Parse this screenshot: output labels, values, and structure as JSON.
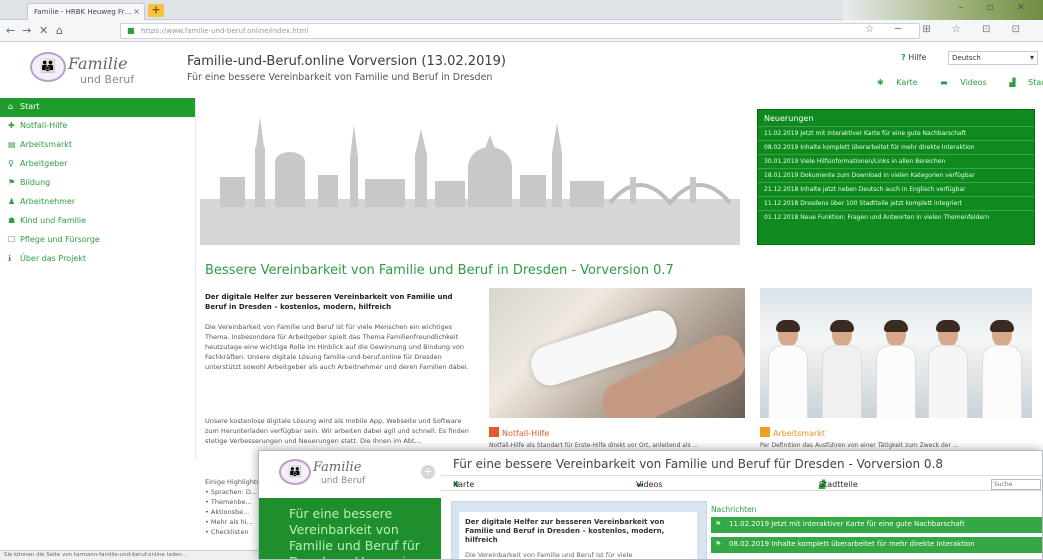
{
  "browser": {
    "tab_title": "Familie - HRBK Heuweg Fr…",
    "tab_close": "×",
    "new_tab": "+",
    "window_controls": "– ▫ ✕",
    "nav": {
      "back": "←",
      "forward": "→",
      "close": "✕",
      "home": "⌂"
    },
    "url": "https://www.familie-und-beruf.online/index.html",
    "toolbar_icons": "☆ ─ ⊞ ☆   ⊡ ⊡"
  },
  "header": {
    "logo_line1": "Familie",
    "logo_line2": "und Beruf",
    "title": "Familie-und-Beruf.online Vorversion (13.02.2019)",
    "subtitle": "Für eine bessere Vereinbarkeit von Familie und Beruf in Dresden",
    "help_label": "Hilfe",
    "language": "Deutsch",
    "links": [
      "Karte",
      "Videos",
      "Stadtteile"
    ]
  },
  "sidebar": {
    "items": [
      {
        "icon": "⌂",
        "label": "Start",
        "active": true
      },
      {
        "icon": "✚",
        "label": "Notfall-Hilfe"
      },
      {
        "icon": "▤",
        "label": "Arbeitsmarkt"
      },
      {
        "icon": "♀",
        "label": "Arbeitgeber"
      },
      {
        "icon": "⚑",
        "label": "Bildung"
      },
      {
        "icon": "♟",
        "label": "Arbeitnehmer"
      },
      {
        "icon": "☗",
        "label": "Kind und Familie"
      },
      {
        "icon": "☐",
        "label": "Pflege und Fürsorge"
      },
      {
        "icon": "ℹ",
        "label": "Über das Projekt"
      }
    ]
  },
  "news": {
    "title": "Neuerungen",
    "items": [
      "11.02.2019 Jetzt mit interaktiver Karte für eine gute Nachbarschaft",
      "08.02.2019 Inhalte komplett überarbeitet für mehr direkte Interaktion",
      "30.01.2019 Viele Hilfsinformationen/Links in allen Bereichen",
      "18.01.2019 Dokumente zum Download in vielen Kategorien verfügbar",
      "21.12.2018 Inhalte jetzt neben Deutsch auch in Englisch verfügbar",
      "11.12.2018 Dresdens über 100 Stadtteile jetzt komplett integriert",
      "01.12.2018 Neue Funktion: Fragen und Antworten in vielen Themenfeldern"
    ]
  },
  "main": {
    "title": "Bessere Vereinbarkeit von Familie und Beruf in Dresden - Vorversion 0.7",
    "lead": "Der digitale Helfer zur besseren Vereinbarkeit von Familie und Beruf in Dresden – kostenlos, modern, hilfreich",
    "para1": "Die Vereinbarkeit von Familie und Beruf ist für viele Menschen ein wichtiges Thema. Insbesondere für Arbeitgeber spielt das Thema Familienfreundlichkeit heutzutage eine wichtige Rolle im Hinblick auf die Gewinnung und Bindung von Fachkräften. Unsere digitale Lösung familie-und-beruf.online für Dresden unterstützt sowohl Arbeitgeber als auch Arbeitnehmer und deren Familien dabei.",
    "para2": "Unsere kostenlose digitale Lösung wird als mobile App, Webseite und Software zum Herunterladen verfügbar sein. Wir arbeiten dabei agil und schnell. Es finden stetige Verbesserungen und Neuerungen statt. Die Ihnen im Abt...",
    "para3": "Einige Highlights:\n• Sprachen: D...\n• Themenbe...\n• Aktionsbe...\n• Mehr als hi...\n• Checklisten",
    "card1_title": "Notfall-Hilfe",
    "card1_desc": "Notfall-Hilfe als Standart für Erste-Hilfe direkt vor Ort, anleitend als ...",
    "card2_title": "Arbeitsmarkt",
    "card2_desc": "Per Definition das Ausführen von einer Tätigkeit zum Zweck der ..."
  },
  "status_bar": "Sie können die Seite von tarmann-familie-und-beruf.online laden...",
  "window2": {
    "logo_line1": "Familie",
    "logo_line2": "und Beruf",
    "plus": "+",
    "tagline": "Für eine bessere Vereinbarkeit von Familie und Beruf für Dresden – Vorversion 0.8",
    "title": "Für eine bessere Vereinbarkeit von Familie und Beruf für Dresden - Vorversion 0.8",
    "nav": [
      "Karte",
      "Videos",
      "Stadtteile"
    ],
    "search_placeholder": "Suche",
    "box_title": "Der digitale Helfer zur besseren Vereinbarkeit von Familie und Beruf in Dresden – kostenlos, modern, hilfreich",
    "box_sub": "Die Vereinbarkeit von Familie und Beruf ist für viele",
    "news_head": "Nachrichten",
    "news": [
      "11.02.2019  Jetzt mit interaktiver Karte für eine gute Nachbarschaft",
      "08.02.2019  Inhalte komplett überarbeitet für mehr direkte Interaktion"
    ]
  },
  "colors": {
    "brand_green": "#2e9e3f",
    "news_bg": "#0f8a1e",
    "sidebar_active": "#1f9d2c",
    "accent_orange": "#e05c2b"
  }
}
